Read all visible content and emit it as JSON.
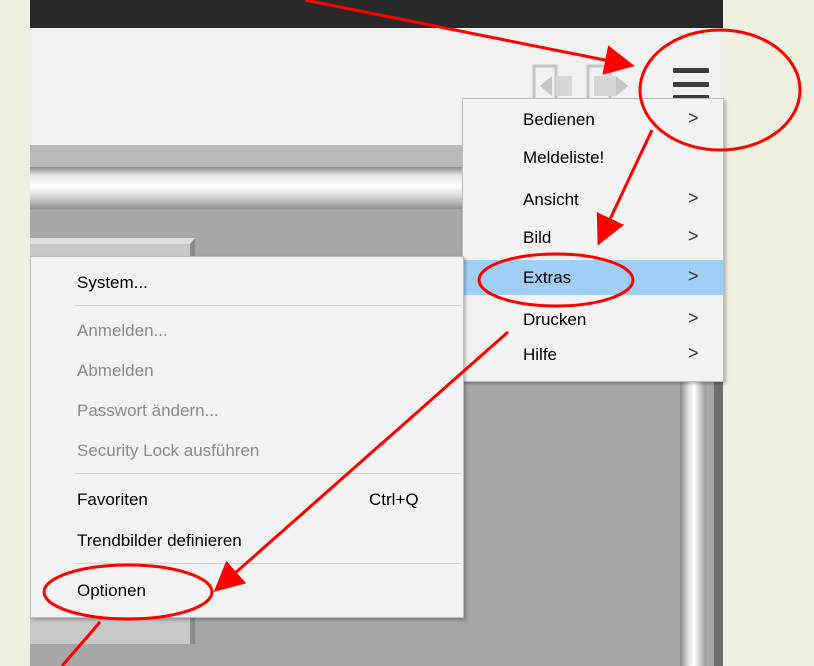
{
  "menu": {
    "items": [
      {
        "label": "Bedienen",
        "arrow": ">"
      },
      {
        "label": "Meldeliste!",
        "arrow": ""
      },
      {
        "label": "Ansicht",
        "arrow": ">"
      },
      {
        "label": "Bild",
        "arrow": ">"
      },
      {
        "label": "Extras",
        "arrow": ">",
        "selected": true
      },
      {
        "label": "Drucken",
        "arrow": ">"
      },
      {
        "label": "Hilfe",
        "arrow": ">"
      }
    ]
  },
  "extras_menu": {
    "items": [
      {
        "label": "System...",
        "enabled": true
      },
      {
        "label": "Anmelden...",
        "enabled": false
      },
      {
        "label": "Abmelden",
        "enabled": false
      },
      {
        "label": "Passwort ändern...",
        "enabled": false
      },
      {
        "label": "Security Lock ausführen",
        "enabled": false
      },
      {
        "label": "Favoriten",
        "shortcut": "Ctrl+Q",
        "enabled": true
      },
      {
        "label": "Trendbilder definieren",
        "enabled": true
      },
      {
        "label": "Optionen",
        "enabled": true
      }
    ]
  },
  "icons": {
    "nav_back": "navigate-back-icon",
    "nav_forward": "navigate-forward-icon",
    "menu": "hamburger-menu-icon"
  },
  "colors": {
    "page_background": "#efefdf",
    "menu_highlight": "#9fcef6",
    "annotation": "#ff0000",
    "disabled_text": "#8a8a8a",
    "top_bar": "#282828"
  }
}
